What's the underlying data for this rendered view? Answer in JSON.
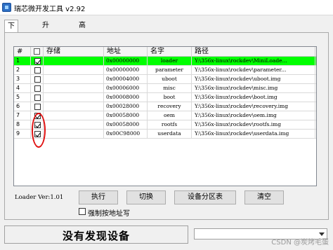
{
  "window": {
    "title": "瑞芯微开发工具 v2.92"
  },
  "tabs": [
    {
      "label": "下载镜像",
      "active": true
    },
    {
      "label": "升级固件",
      "active": false
    },
    {
      "label": "高级功能",
      "active": false
    }
  ],
  "grid": {
    "headers": {
      "no": "#",
      "store": "存储",
      "address": "地址",
      "name": "名字",
      "path": "路径",
      "more": "..."
    },
    "rows": [
      {
        "no": "1",
        "checked": true,
        "selected": true,
        "store": "",
        "address": "0x00000000",
        "name": "loader",
        "path": "Y:\\356x-linux\\rockdev\\MiniLoade..."
      },
      {
        "no": "2",
        "checked": false,
        "selected": false,
        "store": "",
        "address": "0x00000000",
        "name": "parameter",
        "path": "Y:\\356x-linux\\rockdev\\parameter..."
      },
      {
        "no": "3",
        "checked": false,
        "selected": false,
        "store": "",
        "address": "0x00004000",
        "name": "uboot",
        "path": "Y:\\356x-linux\\rockdev\\uboot.img"
      },
      {
        "no": "4",
        "checked": false,
        "selected": false,
        "store": "",
        "address": "0x00006000",
        "name": "misc",
        "path": "Y:\\356x-linux\\rockdev\\misc.img"
      },
      {
        "no": "5",
        "checked": false,
        "selected": false,
        "store": "",
        "address": "0x00008000",
        "name": "boot",
        "path": "Y:\\356x-linux\\rockdev\\boot.img"
      },
      {
        "no": "6",
        "checked": false,
        "selected": false,
        "store": "",
        "address": "0x00028000",
        "name": "recovery",
        "path": "Y:\\356x-linux\\rockdev\\recovery.img"
      },
      {
        "no": "7",
        "checked": true,
        "selected": false,
        "store": "",
        "address": "0x00058000",
        "name": "oem",
        "path": "Y:\\356x-linux\\rockdev\\oem.img"
      },
      {
        "no": "8",
        "checked": true,
        "selected": false,
        "store": "",
        "address": "0x00058000",
        "name": "rootfs",
        "path": "Y:\\356x-linux\\rockdev\\rootfs.img"
      },
      {
        "no": "9",
        "checked": true,
        "selected": false,
        "store": "",
        "address": "0x00C98000",
        "name": "userdata",
        "path": "Y:\\356x-linux\\rockdev\\userdata.img"
      }
    ]
  },
  "loader_version": "Loader Ver:1.01",
  "buttons": {
    "run": "执行",
    "switch": "切换",
    "partition": "设备分区表",
    "clear": "清空"
  },
  "force_address": {
    "label": "强制按地址写",
    "checked": false
  },
  "status": {
    "text": "没有发现设备"
  },
  "dropdown": {
    "value": ""
  },
  "watermark": "CSDN @炭烤毛蛋",
  "colors": {
    "selected_row": "#00ff00",
    "annotation": "#e01010"
  }
}
